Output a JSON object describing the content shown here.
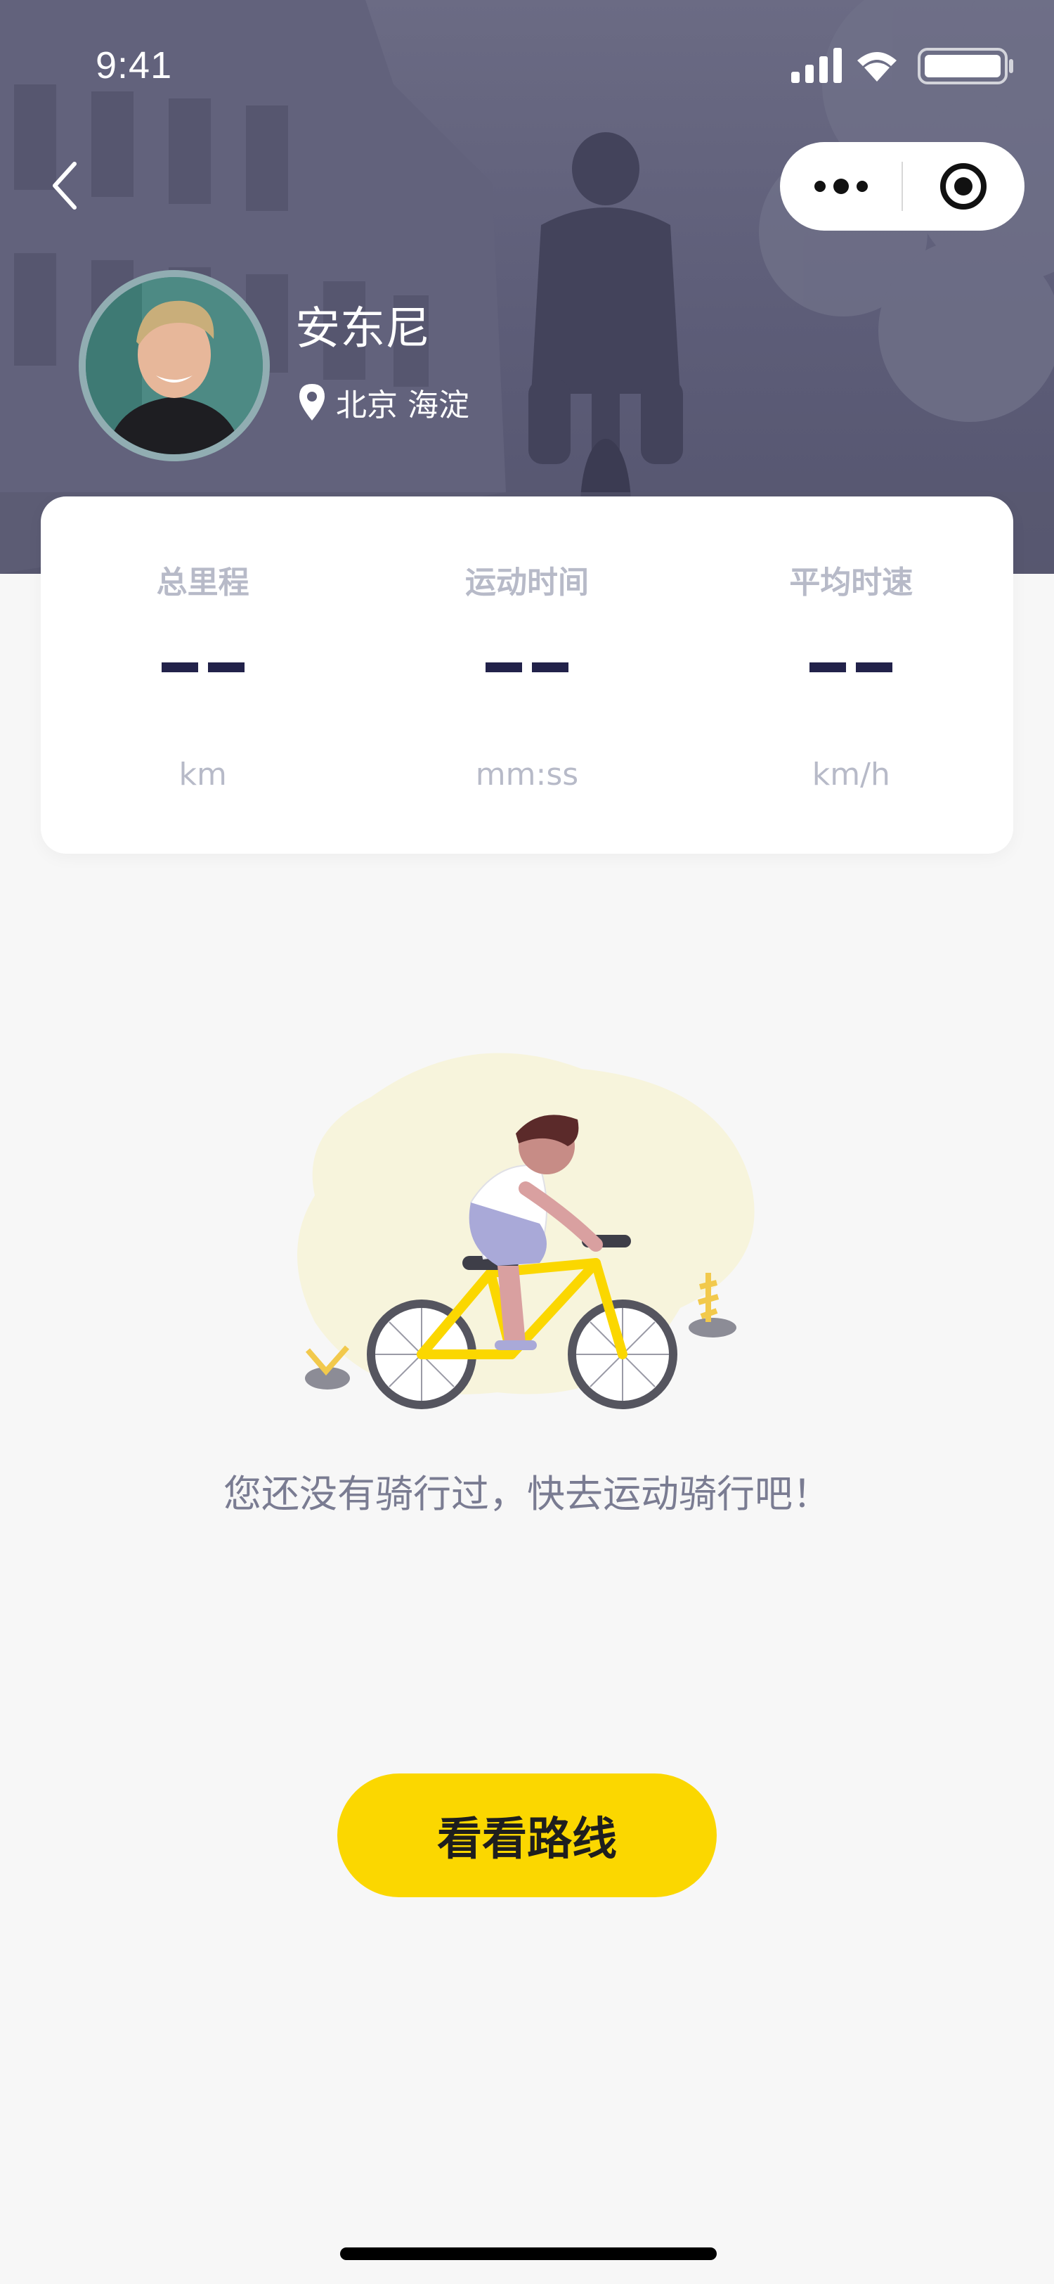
{
  "status_bar": {
    "time": "9:41"
  },
  "profile": {
    "name": "安东尼",
    "location_city": "北京",
    "location_district": "海淀"
  },
  "stats": [
    {
      "label": "总里程",
      "value": "--",
      "unit": "km"
    },
    {
      "label": "运动时间",
      "value": "--",
      "unit": "mm:ss"
    },
    {
      "label": "平均时速",
      "value": "--",
      "unit": "km/h"
    }
  ],
  "empty_state": {
    "message": "您还没有骑行过，快去运动骑行吧！"
  },
  "cta": {
    "label": "看看路线"
  },
  "colors": {
    "accent": "#fbd700",
    "header_overlay": "#5d5d78",
    "stat_value": "#22224a",
    "muted_text": "#b7bac8",
    "body_text": "#7a7c92",
    "background": "#f7f7f7"
  },
  "icons": {
    "back": "chevron-left-icon",
    "more": "more-dots-icon",
    "close": "target-circle-icon",
    "location": "location-pin-icon"
  }
}
